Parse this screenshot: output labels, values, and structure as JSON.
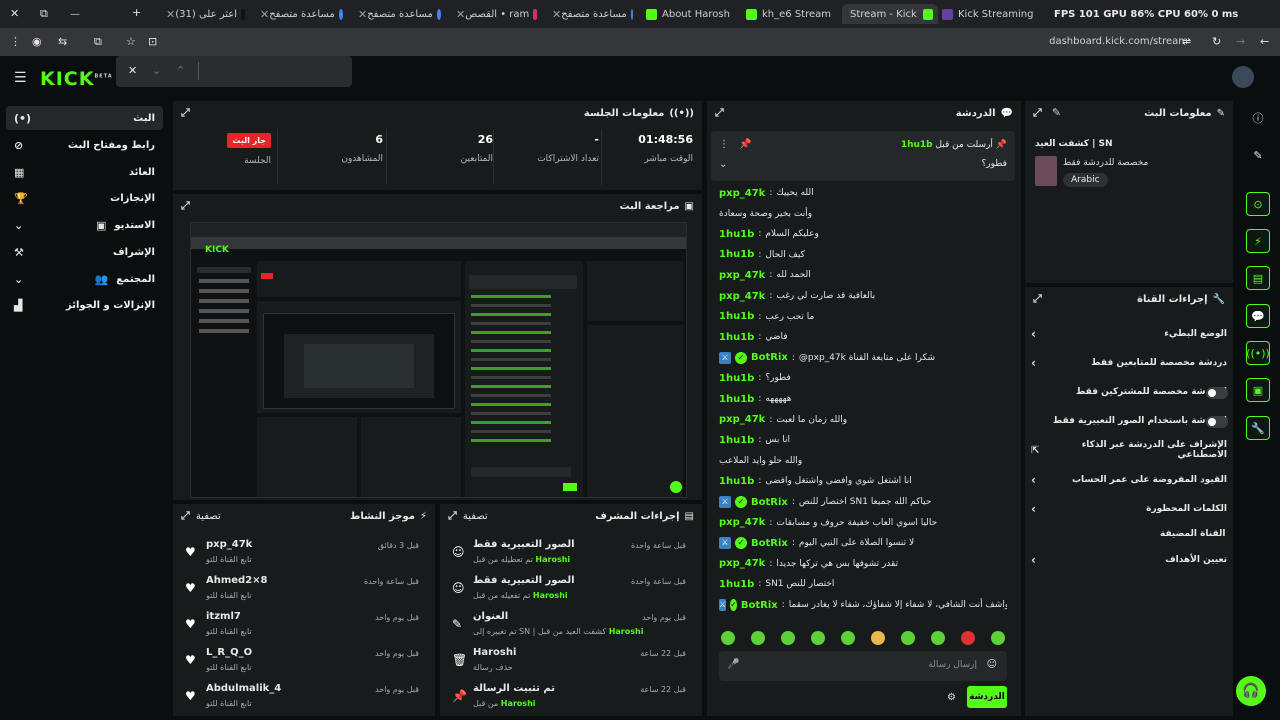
{
  "browser": {
    "tabs": [
      {
        "label": "—"
      },
      {
        "label": "(31) اعثر على"
      },
      {
        "label": "مساعدة متصفح"
      },
      {
        "label": "مساعدة متصفح"
      },
      {
        "label": "القصص • ram"
      },
      {
        "label": "مساعدة متصفح"
      },
      {
        "label": "About Harosh"
      },
      {
        "label": "kh_e6 Stream"
      },
      {
        "label": "Stream - Kick"
      },
      {
        "label": "Kick Streaming"
      }
    ],
    "perf": "FPS 101   GPU 86%   CPU 60%   0 ms",
    "url": "dashboard.kick.com/stream"
  },
  "header": {
    "logo": "KICK",
    "logo_sup": "BETA"
  },
  "sidebar": {
    "items": [
      {
        "label": "البث",
        "icon": "broadcast-icon"
      },
      {
        "label": "رابط ومفتاح البث",
        "icon": "link-icon"
      },
      {
        "label": "العائد",
        "icon": "revenue-icon"
      },
      {
        "label": "الإنجازات",
        "icon": "trophy-icon"
      },
      {
        "label": "الاستديو",
        "icon": "studio-icon"
      },
      {
        "label": "الإشراف",
        "icon": "moderation-icon"
      },
      {
        "label": "المجتمع",
        "icon": "community-icon"
      },
      {
        "label": "الإنزالات و الجوائز",
        "icon": "drops-icon"
      }
    ]
  },
  "session": {
    "title": "معلومات الجلسة",
    "live_badge": "جار البث",
    "session_label": "الجلسة",
    "stats": [
      {
        "value": "6",
        "label": "المشاهدون"
      },
      {
        "value": "26",
        "label": "المتابعين"
      },
      {
        "value": "-",
        "label": "تعداد الاشتراكات"
      },
      {
        "value": "01:48:56",
        "label": "الوقت مباشر"
      }
    ]
  },
  "preview": {
    "title": "مراجعة البث"
  },
  "activity": {
    "title": "موجز النشاط",
    "filter": "تصفية",
    "rows": [
      {
        "name": "pxp_47k",
        "sub": "تابع القناة للتو",
        "time": "قبل 3 دقائق"
      },
      {
        "name": "Ahmed2×8",
        "sub": "تابع القناة للتو",
        "time": "قبل ساعة واحدة"
      },
      {
        "name": "itzml7",
        "sub": "تابع القناة للتو",
        "time": "قبل يوم واحد"
      },
      {
        "name": "L_R_Q_O",
        "sub": "تابع القناة للتو",
        "time": "قبل يوم واحد"
      },
      {
        "name": "Abdulmalik_4",
        "sub": "تابع القناة للتو",
        "time": "قبل يوم واحد"
      }
    ]
  },
  "modactions": {
    "title": "إجراءات المشرف",
    "filter": "تصفية",
    "rows": [
      {
        "title": "الصور التعبيرية فقط",
        "sub": "تم تعطيله من قبل",
        "user": "Haroshi",
        "time": "قبل ساعة واحدة"
      },
      {
        "title": "الصور التعبيرية فقط",
        "sub": "تم تفعيله من قبل",
        "user": "Haroshi",
        "time": "قبل ساعة واحدة"
      },
      {
        "title": "العنوان",
        "sub": "تم تغييره إلى SN | كشفت العيد من قبل",
        "user": "Haroshi",
        "time": "قبل يوم واحد"
      },
      {
        "title": "Haroshi",
        "sub": "حذف رسالة",
        "user": "",
        "time": "قبل 22 ساعة"
      },
      {
        "title": "تم تثبيت الرسالة",
        "sub": "من قبل",
        "user": "Haroshi",
        "time": "قبل 22 ساعة"
      }
    ]
  },
  "chat": {
    "title": "الدردشة",
    "pinned_user": "1hu1b",
    "pinned_by": "أرسلت من قبل",
    "pinned_msg": "فطور؟",
    "lines": [
      {
        "user": "pxp_47k",
        "bot": false,
        "msg": "الله يحييك"
      },
      {
        "user": "",
        "bot": false,
        "msg": "وأنت بخير وصحة وسعادة"
      },
      {
        "user": "1hu1b",
        "bot": false,
        "msg": "وعليكم السلام"
      },
      {
        "user": "1hu1b",
        "bot": false,
        "msg": "كيف الحال"
      },
      {
        "user": "pxp_47k",
        "bot": false,
        "msg": "الحمد لله"
      },
      {
        "user": "pxp_47k",
        "bot": false,
        "msg": "بالعافية قد صارت لي رغب"
      },
      {
        "user": "1hu1b",
        "bot": false,
        "msg": "ما تحب رعب"
      },
      {
        "user": "1hu1b",
        "bot": false,
        "msg": "فاضي"
      },
      {
        "user": "BotRix",
        "bot": true,
        "msg": "@pxp_47k شكرا على متابعة القناة"
      },
      {
        "user": "1hu1b",
        "bot": false,
        "msg": "فطور؟"
      },
      {
        "user": "1hu1b",
        "bot": false,
        "msg": "هههههه"
      },
      {
        "user": "pxp_47k",
        "bot": false,
        "msg": "والله زمان ما لعبت"
      },
      {
        "user": "1hu1b",
        "bot": false,
        "msg": "انا بس"
      },
      {
        "user": "",
        "bot": false,
        "msg": "والله حلو وايد الملاعب"
      },
      {
        "user": "1hu1b",
        "bot": false,
        "msg": "انا اشتغل شوي وافضى واشتغل وافضى"
      },
      {
        "user": "BotRix",
        "bot": true,
        "msg": "اختصار للنص SN1 حياكم الله جميعا"
      },
      {
        "user": "pxp_47k",
        "bot": false,
        "msg": "حاليا اسوي العاب خفيفة حروف و مسابقات"
      },
      {
        "user": "BotRix",
        "bot": true,
        "msg": "لا تنسوا الصلاة على النبي اليوم"
      },
      {
        "user": "pxp_47k",
        "bot": false,
        "msg": "تقدر تشوفها بس هي تركها جديدا"
      },
      {
        "user": "1hu1b",
        "bot": false,
        "msg": "SN1 اختصار للنص"
      },
      {
        "user": "BotRix",
        "bot": true,
        "msg": "اللهم رب الناس أذهب البأس، واشف أنت الشافي، لا شفاء إلا شفاؤك، شفاء لا يغادر سقما"
      }
    ],
    "input_placeholder": "إرسال رسالة",
    "send_label": "الدردشة"
  },
  "stream_info": {
    "title": "معلومات البث",
    "stream_title": "كشفت العيد | SN",
    "subtitle": "مخصصة للدردشة فقط",
    "tag": "Arabic"
  },
  "channel_actions": {
    "title": "إجراءات القناة",
    "items": [
      {
        "label": "الوضع البطيء",
        "control": "chevron"
      },
      {
        "label": "دردشة مخصصة للمتابعين فقط",
        "control": "chevron"
      },
      {
        "label": "الدردشة مخصصة للمشتركين فقط",
        "control": "toggle"
      },
      {
        "label": "الدردشة باستخدام الصور التعبيرية فقط",
        "control": "toggle"
      },
      {
        "label": "الإشراف على الدردشة عبر الذكاء الاصطناعي",
        "control": "link"
      },
      {
        "label": "القيود المفروضة على عمر الحساب",
        "control": "chevron"
      },
      {
        "label": "الكلمات المحظورة",
        "control": "chevron"
      }
    ],
    "fav_channel": "القناة المضيفة",
    "goals": "تعيين الأهداف"
  },
  "colors": {
    "accent": "#53fc18",
    "live": "#e5252a"
  }
}
